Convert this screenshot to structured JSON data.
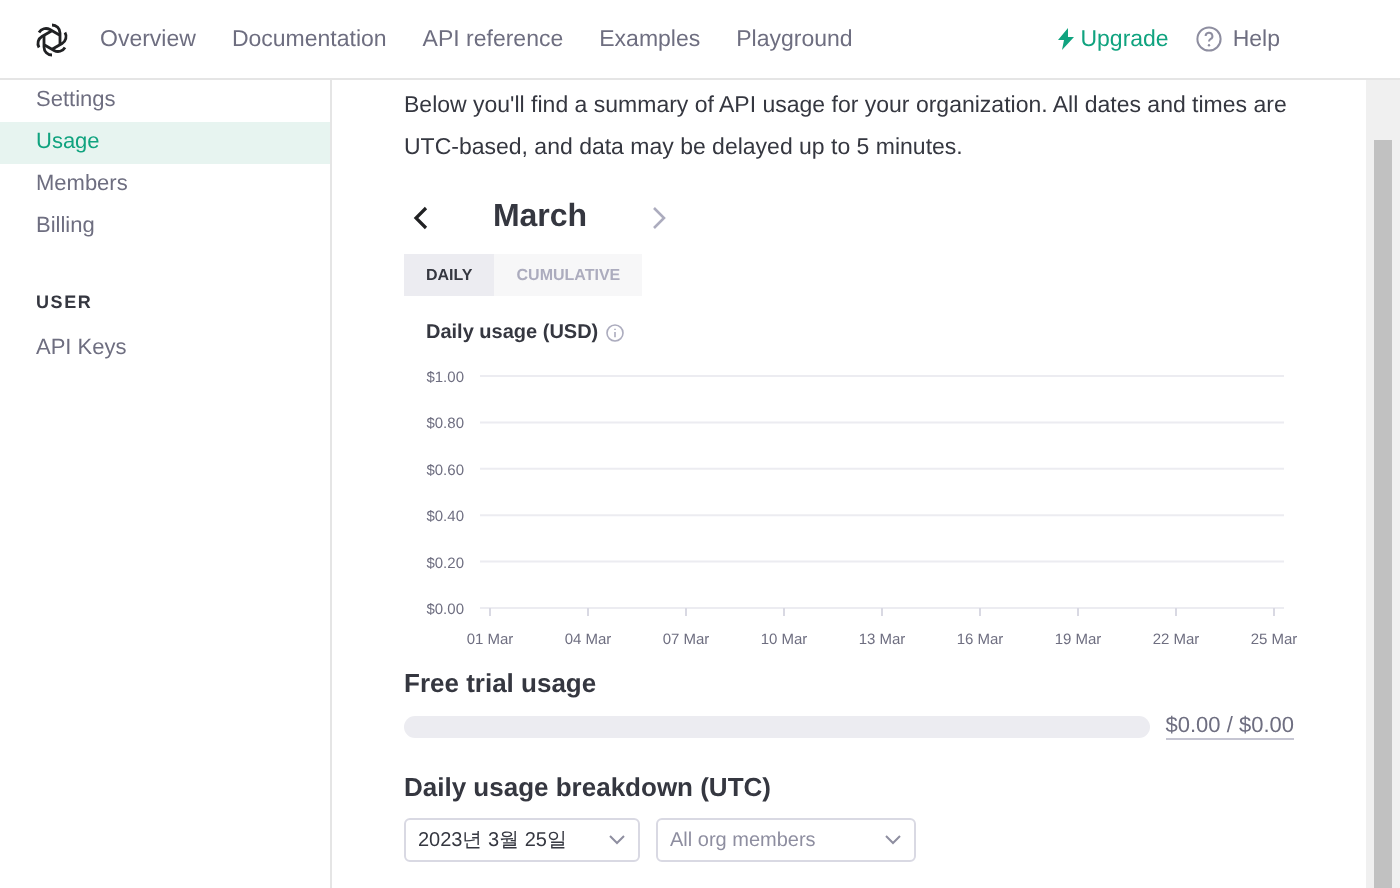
{
  "nav": {
    "links": [
      {
        "label": "Overview"
      },
      {
        "label": "Documentation"
      },
      {
        "label": "API reference"
      },
      {
        "label": "Examples"
      },
      {
        "label": "Playground"
      }
    ],
    "upgrade": "Upgrade",
    "help": "Help"
  },
  "sidebar": {
    "items": [
      {
        "label": "Settings",
        "selected": false
      },
      {
        "label": "Usage",
        "selected": true
      },
      {
        "label": "Members",
        "selected": false
      },
      {
        "label": "Billing",
        "selected": false
      }
    ],
    "section": "USER",
    "section_items": [
      {
        "label": "API Keys",
        "selected": false
      }
    ]
  },
  "intro": "Below you'll find a summary of API usage for your organization. All dates and times are UTC-based, and data may be delayed up to 5 minutes.",
  "month": "March",
  "tabs": [
    {
      "label": "DAILY",
      "selected": true
    },
    {
      "label": "CUMULATIVE",
      "selected": false
    }
  ],
  "chart_title": "Daily usage (USD)",
  "chart_data": {
    "type": "bar",
    "categories": [
      "01 Mar",
      "04 Mar",
      "07 Mar",
      "10 Mar",
      "13 Mar",
      "16 Mar",
      "19 Mar",
      "22 Mar",
      "25 Mar"
    ],
    "values": [
      0,
      0,
      0,
      0,
      0,
      0,
      0,
      0,
      0
    ],
    "grid": true,
    "ylim": [
      0,
      1
    ],
    "yticks": [
      {
        "value": 0,
        "label": "$0.00"
      },
      {
        "value": 0.2,
        "label": "$0.20"
      },
      {
        "value": 0.4,
        "label": "$0.40"
      },
      {
        "value": 0.6,
        "label": "$0.60"
      },
      {
        "value": 0.8,
        "label": "$0.80"
      },
      {
        "value": 1,
        "label": "$1.00"
      }
    ]
  },
  "free_trial": {
    "title": "Free trial usage",
    "level": 0,
    "reading": "$0.00 / $0.00"
  },
  "breakdown": {
    "title": "Daily usage breakdown (UTC)",
    "date_value": "2023년 3월 25일",
    "member_value": "All org members"
  }
}
